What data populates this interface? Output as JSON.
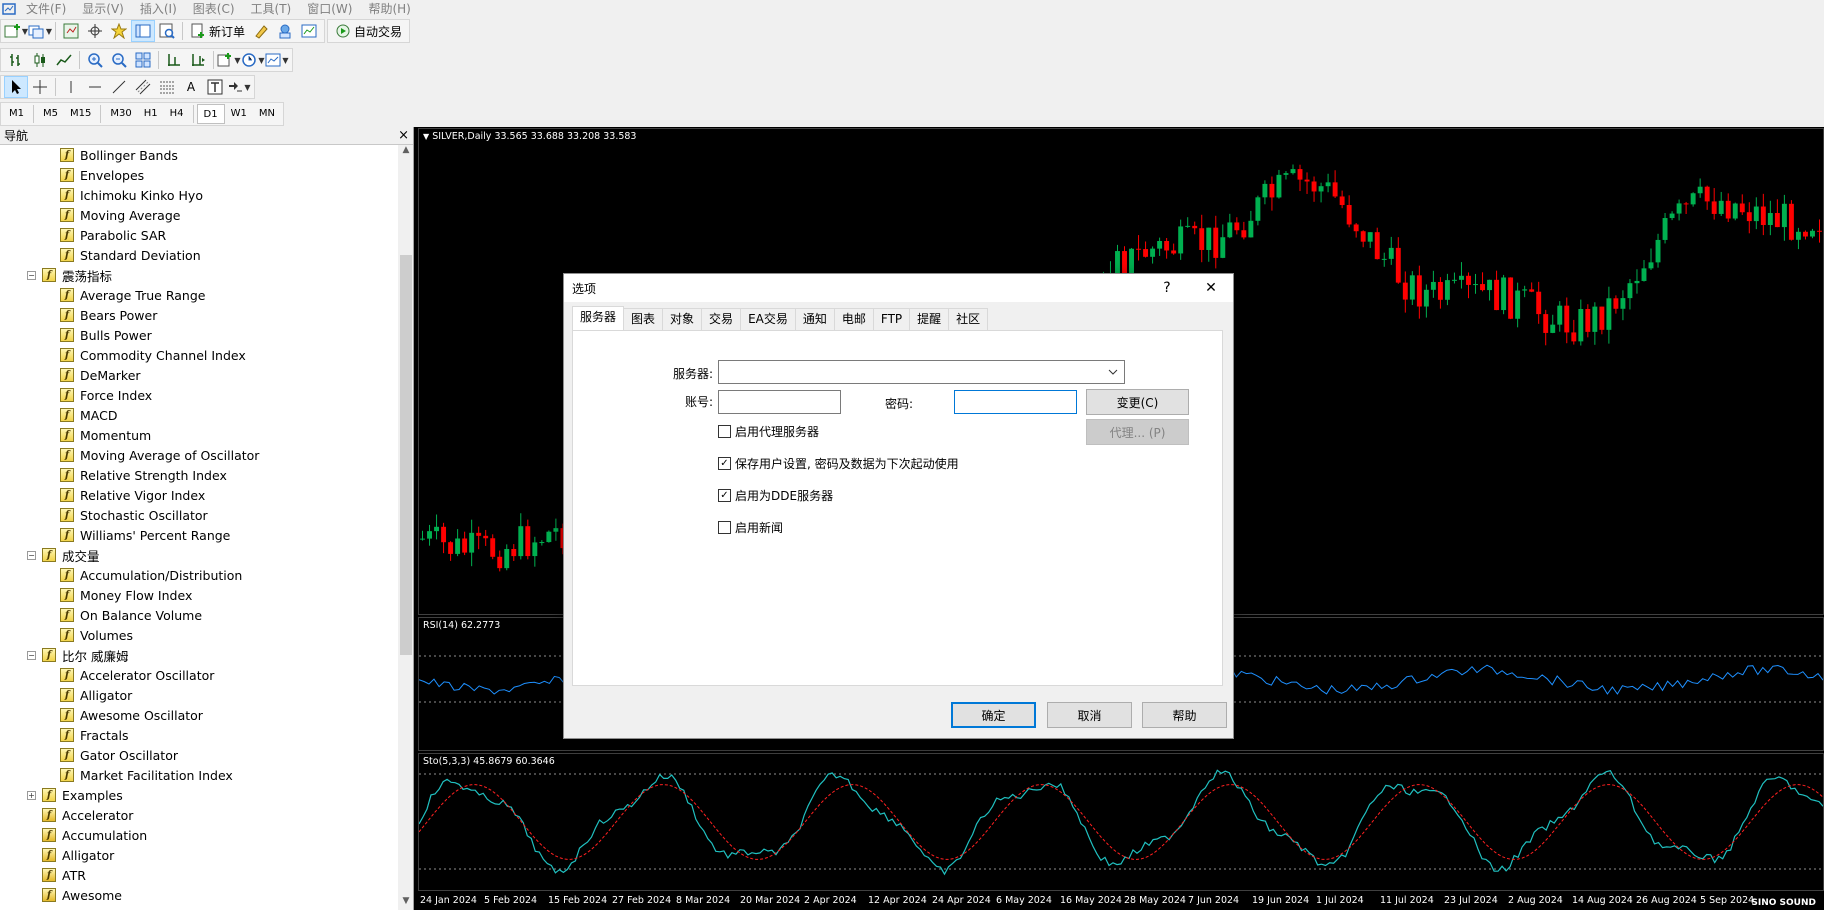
{
  "menu": {
    "items": [
      "文件(F)",
      "显示(V)",
      "插入(I)",
      "图表(C)",
      "工具(T)",
      "窗口(W)",
      "帮助(H)"
    ]
  },
  "toolbar": {
    "new_order": "新订单",
    "auto_trade": "自动交易",
    "timeframes": [
      "M1",
      "M5",
      "M15",
      "M30",
      "H1",
      "H4",
      "D1",
      "W1",
      "MN"
    ],
    "active_timeframe": "D1"
  },
  "navigator": {
    "title": "导航",
    "close": "×",
    "rows": [
      {
        "level": 2,
        "label": "Bollinger Bands"
      },
      {
        "level": 2,
        "label": "Envelopes"
      },
      {
        "level": 2,
        "label": "Ichimoku Kinko Hyo"
      },
      {
        "level": 2,
        "label": "Moving Average"
      },
      {
        "level": 2,
        "label": "Parabolic SAR"
      },
      {
        "level": 2,
        "label": "Standard Deviation"
      },
      {
        "level": 1,
        "label": "震荡指标",
        "expander": "−"
      },
      {
        "level": 2,
        "label": "Average True Range"
      },
      {
        "level": 2,
        "label": "Bears Power"
      },
      {
        "level": 2,
        "label": "Bulls Power"
      },
      {
        "level": 2,
        "label": "Commodity Channel Index"
      },
      {
        "level": 2,
        "label": "DeMarker"
      },
      {
        "level": 2,
        "label": "Force Index"
      },
      {
        "level": 2,
        "label": "MACD"
      },
      {
        "level": 2,
        "label": "Momentum"
      },
      {
        "level": 2,
        "label": "Moving Average of Oscillator"
      },
      {
        "level": 2,
        "label": "Relative Strength Index"
      },
      {
        "level": 2,
        "label": "Relative Vigor Index"
      },
      {
        "level": 2,
        "label": "Stochastic Oscillator"
      },
      {
        "level": 2,
        "label": "Williams' Percent Range"
      },
      {
        "level": 1,
        "label": "成交量",
        "expander": "−"
      },
      {
        "level": 2,
        "label": "Accumulation/Distribution"
      },
      {
        "level": 2,
        "label": "Money Flow Index"
      },
      {
        "level": 2,
        "label": "On Balance Volume"
      },
      {
        "level": 2,
        "label": "Volumes"
      },
      {
        "level": 1,
        "label": "比尔 威廉姆",
        "expander": "−"
      },
      {
        "level": 2,
        "label": "Accelerator Oscillator"
      },
      {
        "level": 2,
        "label": "Alligator"
      },
      {
        "level": 2,
        "label": "Awesome Oscillator"
      },
      {
        "level": 2,
        "label": "Fractals"
      },
      {
        "level": 2,
        "label": "Gator Oscillator"
      },
      {
        "level": 2,
        "label": "Market Facilitation Index"
      },
      {
        "level": 1,
        "label": "Examples",
        "expander": "+"
      },
      {
        "level": 1,
        "label": "Accelerator",
        "ea": true
      },
      {
        "level": 1,
        "label": "Accumulation",
        "ea": true
      },
      {
        "level": 1,
        "label": "Alligator",
        "ea": true
      },
      {
        "level": 1,
        "label": "ATR",
        "ea": true
      },
      {
        "level": 1,
        "label": "Awesome",
        "ea": true
      }
    ]
  },
  "chart": {
    "main_label": "SILVER,Daily  33.565 33.688 33.208 33.583",
    "rsi_label": "RSI(14) 62.2773",
    "sto_label": "Sto(5,3,3) 45.8679 60.3646",
    "dates": [
      "24 Jan 2024",
      "5 Feb 2024",
      "15 Feb 2024",
      "27 Feb 2024",
      "8 Mar 2024",
      "20 Mar 2024",
      "2 Apr 2024",
      "12 Apr 2024",
      "24 Apr 2024",
      "6 May 2024",
      "16 May 2024",
      "28 May 2024",
      "7 Jun 2024",
      "19 Jun 2024",
      "1 Jul 2024",
      "11 Jul 2024",
      "23 Jul 2024",
      "2 Aug 2024",
      "14 Aug 2024",
      "26 Aug 2024",
      "5 Sep 2024"
    ],
    "watermark": "SINO SOUND",
    "colors": {
      "bull": "#00b050",
      "bear": "#ff0000",
      "rsi": "#1e90ff",
      "sto_main": "#20c0c0",
      "sto_signal": "#ff2020"
    }
  },
  "dialog": {
    "title": "选项",
    "help": "?",
    "close": "✕",
    "tabs": [
      "服务器",
      "图表",
      "对象",
      "交易",
      "EA交易",
      "通知",
      "电邮",
      "FTP",
      "提醒",
      "社区"
    ],
    "active_tab": 0,
    "server_label": "服务器:",
    "server_value": "",
    "account_label": "账号:",
    "account_value": "",
    "password_label": "密码:",
    "password_value": "",
    "change_button": "变更(C)",
    "proxy_button": "代理... (P)",
    "checkboxes": [
      {
        "label": "启用代理服务器",
        "checked": false
      },
      {
        "label": "保存用户设置, 密码及数据为下次起动使用",
        "checked": true
      },
      {
        "label": "启用为DDE服务器",
        "checked": true
      },
      {
        "label": "启用新闻",
        "checked": false
      }
    ],
    "ok": "确定",
    "cancel": "取消",
    "help_button": "帮助"
  }
}
